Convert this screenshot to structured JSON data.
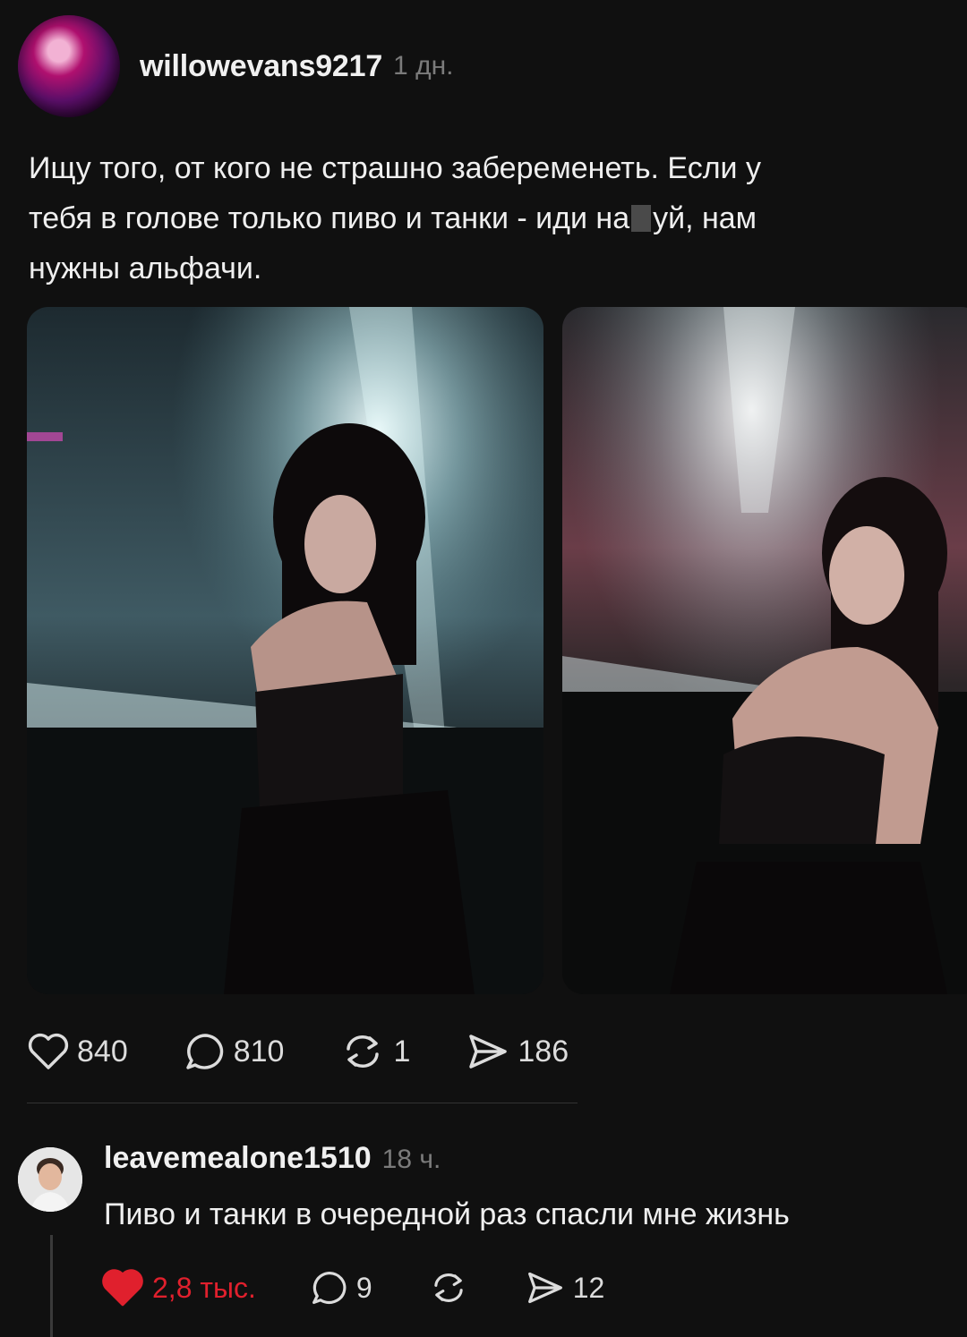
{
  "post": {
    "username": "willowevans9217",
    "time": "1 дн.",
    "text_line1": "Ищу того, от кого не страшно забеременеть. Если у",
    "text_line2_a": "тебя в голове только пиво и танки - иди на",
    "text_line2_b": "уй, нам",
    "text_line3": "нужны альфачи.",
    "stats": {
      "likes": "840",
      "comments": "810",
      "reposts": "1",
      "shares": "186"
    }
  },
  "reply": {
    "username": "leavemealone1510",
    "time": "18 ч.",
    "text": "Пиво и танки в очередной раз спасли мне жизнь",
    "stats": {
      "likes": "2,8 тыс.",
      "comments": "9",
      "shares": "12"
    }
  },
  "icons": {
    "like": "heart-icon",
    "comment": "comment-bubble-icon",
    "repost": "repost-arrows-icon",
    "share": "send-arrow-icon"
  },
  "colors": {
    "background": "#101010",
    "liked": "#e0202d",
    "muted": "#7b7b7b"
  }
}
